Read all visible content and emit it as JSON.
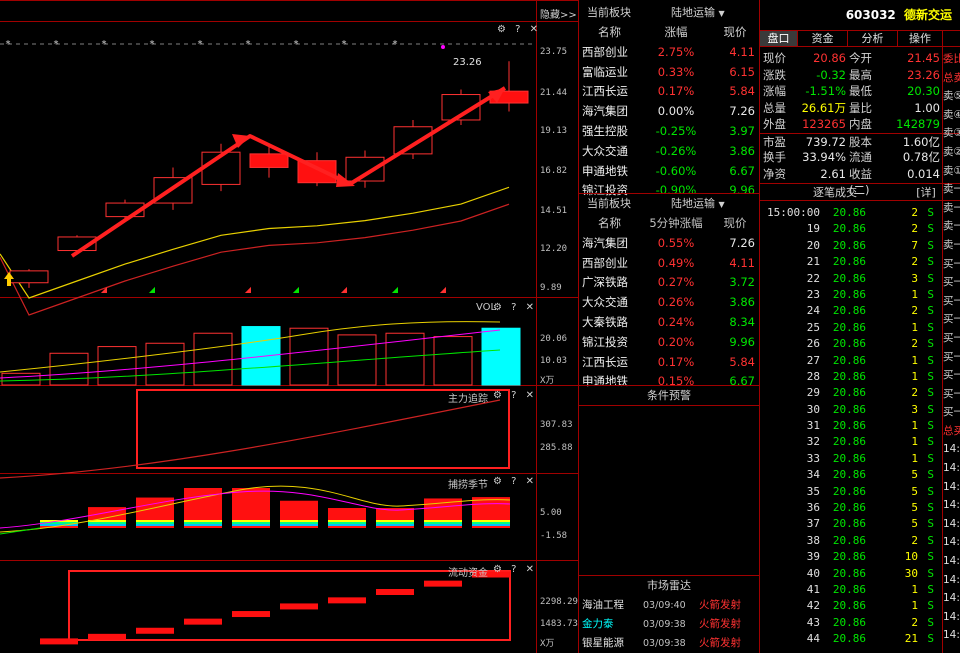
{
  "chart_top": {
    "hide_label": "隐藏>>",
    "icons": "⚙ ? ✕"
  },
  "price_axis": [
    "23.75",
    "21.44",
    "19.13",
    "16.82",
    "14.51",
    "12.20",
    "9.89"
  ],
  "high_label": "23.26",
  "vol_panel": {
    "title": "VOL",
    "icons": "⚙ ? ✕",
    "axis": [
      "20.06",
      "10.03",
      "X万"
    ]
  },
  "main_track_panel": {
    "title": "主力追踪",
    "icons": "⚙ ? ✕",
    "axis": [
      "307.83",
      "285.88"
    ]
  },
  "season_panel": {
    "title": "捕捞季节",
    "icons": "⚙ ? ✕",
    "axis": [
      "5.00",
      "-1.58"
    ]
  },
  "flow_panel": {
    "title": "流动资金",
    "icons": "⚙ ? ✕",
    "axis": [
      "2298.29",
      "1483.73",
      "X万"
    ]
  },
  "candles": [
    {
      "o": 10.2,
      "c": 10.9,
      "h": 11.0,
      "l": 9.9
    },
    {
      "o": 12.1,
      "c": 12.9,
      "h": 13.0,
      "l": 11.9
    },
    {
      "o": 14.1,
      "c": 14.9,
      "h": 15.1,
      "l": 13.9
    },
    {
      "o": 14.9,
      "c": 16.4,
      "h": 17.0,
      "l": 14.5
    },
    {
      "o": 16.0,
      "c": 17.9,
      "h": 18.4,
      "l": 15.6
    },
    {
      "o": 17.8,
      "c": 17.0,
      "h": 18.3,
      "l": 16.4
    },
    {
      "o": 17.4,
      "c": 16.1,
      "h": 17.9,
      "l": 15.9
    },
    {
      "o": 16.2,
      "c": 17.6,
      "h": 18.0,
      "l": 15.8
    },
    {
      "o": 17.8,
      "c": 19.4,
      "h": 19.8,
      "l": 17.5
    },
    {
      "o": 19.8,
      "c": 21.3,
      "h": 21.6,
      "l": 19.5
    },
    {
      "o": 21.5,
      "c": 20.8,
      "h": 23.26,
      "l": 20.3
    }
  ],
  "volumes": [
    3.5,
    9.5,
    11.5,
    12.5,
    15.5,
    17.5,
    17.0,
    15.0,
    15.5,
    14.5,
    17.0
  ],
  "season_bars": [
    1.2,
    4.6,
    6.7,
    8.8,
    8.8,
    6.0,
    4.4,
    4.4,
    6.5,
    6.8
  ],
  "flow_bars": [
    1500,
    1560,
    1640,
    1760,
    1860,
    1960,
    2040,
    2150,
    2260,
    2380
  ],
  "block1": {
    "tab": "当前板块",
    "sector": "陆地运输",
    "headers": [
      "名称",
      "涨幅",
      "现价"
    ],
    "rows": [
      {
        "name": "西部创业",
        "pct": "2.75%",
        "price": "4.11",
        "dir": "up"
      },
      {
        "name": "富临运业",
        "pct": "0.33%",
        "price": "6.15",
        "dir": "up"
      },
      {
        "name": "江西长运",
        "pct": "0.17%",
        "price": "5.84",
        "dir": "up"
      },
      {
        "name": "海汽集团",
        "pct": "0.00%",
        "price": "7.26",
        "dir": "flat"
      },
      {
        "name": "强生控股",
        "pct": "-0.25%",
        "price": "3.97",
        "dir": "down"
      },
      {
        "name": "大众交通",
        "pct": "-0.26%",
        "price": "3.86",
        "dir": "down"
      },
      {
        "name": "申通地铁",
        "pct": "-0.60%",
        "price": "6.67",
        "dir": "down"
      },
      {
        "name": "锦江投资",
        "pct": "-0.90%",
        "price": "9.96",
        "dir": "down"
      }
    ]
  },
  "block2": {
    "tab": "当前板块",
    "sector": "陆地运输",
    "headers": [
      "名称",
      "5分钟涨幅",
      "现价"
    ],
    "rows": [
      {
        "name": "海汽集团",
        "pct": "0.55%",
        "price": "7.26",
        "dir": "flat"
      },
      {
        "name": "西部创业",
        "pct": "0.49%",
        "price": "4.11",
        "dir": "up"
      },
      {
        "name": "广深铁路",
        "pct": "0.27%",
        "price": "3.72",
        "dir": "down"
      },
      {
        "name": "大众交通",
        "pct": "0.26%",
        "price": "3.86",
        "dir": "down"
      },
      {
        "name": "大秦铁路",
        "pct": "0.24%",
        "price": "8.34",
        "dir": "down"
      },
      {
        "name": "锦江投资",
        "pct": "0.20%",
        "price": "9.96",
        "dir": "down"
      },
      {
        "name": "江西长运",
        "pct": "0.17%",
        "price": "5.84",
        "dir": "up"
      },
      {
        "name": "申通地铁",
        "pct": "0.15%",
        "price": "6.67",
        "dir": "down"
      }
    ]
  },
  "alert_title": "条件预警",
  "radar": {
    "title": "市场雷达",
    "rows": [
      {
        "name": "海油工程",
        "time": "03/09:40",
        "event": "火箭发射",
        "color": "#e0e0e0"
      },
      {
        "name": "金力泰",
        "time": "03/09:38",
        "event": "火箭发射",
        "color": "#00ffff"
      },
      {
        "name": "银星能源",
        "time": "03/09:38",
        "event": "火箭发射",
        "color": "#e0e0e0"
      }
    ]
  },
  "stock": {
    "code": "603032",
    "name": "德新交运"
  },
  "quote_tabs": [
    "盘口",
    "资金",
    "分析",
    "操作"
  ],
  "quote": [
    {
      "l1": "现价",
      "v1": "20.86",
      "c1": "red",
      "l2": "今开",
      "v2": "21.45",
      "c2": "red"
    },
    {
      "l1": "涨跌",
      "v1": "-0.32",
      "c1": "green",
      "l2": "最高",
      "v2": "23.26",
      "c2": "red"
    },
    {
      "l1": "涨幅",
      "v1": "-1.51%",
      "c1": "green",
      "l2": "最低",
      "v2": "20.30",
      "c2": "green"
    },
    {
      "l1": "总量",
      "v1": "26.61万",
      "c1": "yellow",
      "l2": "量比",
      "v2": "1.00",
      "c2": "white"
    },
    {
      "l1": "外盘",
      "v1": "123265",
      "c1": "red",
      "l2": "内盘",
      "v2": "142879",
      "c2": "green"
    },
    {
      "l1": "市盈",
      "v1": "739.72",
      "c1": "white",
      "l2": "股本",
      "v2": "1.60亿",
      "c2": "white"
    },
    {
      "l1": "换手",
      "v1": "33.94%",
      "c1": "white",
      "l2": "流通",
      "v2": "0.78亿",
      "c2": "white"
    },
    {
      "l1": "净资",
      "v1": "2.61",
      "c1": "white",
      "l2": "收益(二)",
      "v2": "0.014",
      "c2": "white"
    }
  ],
  "ticks_title": "逐笔成交",
  "ticks_detail": "[详]",
  "ticks": [
    {
      "t": "15:00:00",
      "p": "20.86",
      "v": "2",
      "s": "S"
    },
    {
      "t": "19",
      "p": "20.86",
      "v": "2",
      "s": "S"
    },
    {
      "t": "20",
      "p": "20.86",
      "v": "7",
      "s": "S"
    },
    {
      "t": "21",
      "p": "20.86",
      "v": "2",
      "s": "S"
    },
    {
      "t": "22",
      "p": "20.86",
      "v": "3",
      "s": "S"
    },
    {
      "t": "23",
      "p": "20.86",
      "v": "1",
      "s": "S"
    },
    {
      "t": "24",
      "p": "20.86",
      "v": "2",
      "s": "S"
    },
    {
      "t": "25",
      "p": "20.86",
      "v": "1",
      "s": "S"
    },
    {
      "t": "26",
      "p": "20.86",
      "v": "2",
      "s": "S"
    },
    {
      "t": "27",
      "p": "20.86",
      "v": "1",
      "s": "S"
    },
    {
      "t": "28",
      "p": "20.86",
      "v": "1",
      "s": "S"
    },
    {
      "t": "29",
      "p": "20.86",
      "v": "2",
      "s": "S"
    },
    {
      "t": "30",
      "p": "20.86",
      "v": "3",
      "s": "S"
    },
    {
      "t": "31",
      "p": "20.86",
      "v": "1",
      "s": "S"
    },
    {
      "t": "32",
      "p": "20.86",
      "v": "1",
      "s": "S"
    },
    {
      "t": "33",
      "p": "20.86",
      "v": "1",
      "s": "S"
    },
    {
      "t": "34",
      "p": "20.86",
      "v": "5",
      "s": "S"
    },
    {
      "t": "35",
      "p": "20.86",
      "v": "5",
      "s": "S"
    },
    {
      "t": "36",
      "p": "20.86",
      "v": "5",
      "s": "S"
    },
    {
      "t": "37",
      "p": "20.86",
      "v": "5",
      "s": "S"
    },
    {
      "t": "38",
      "p": "20.86",
      "v": "2",
      "s": "S"
    },
    {
      "t": "39",
      "p": "20.86",
      "v": "10",
      "s": "S"
    },
    {
      "t": "40",
      "p": "20.86",
      "v": "30",
      "s": "S"
    },
    {
      "t": "41",
      "p": "20.86",
      "v": "1",
      "s": "S"
    },
    {
      "t": "42",
      "p": "20.86",
      "v": "1",
      "s": "S"
    },
    {
      "t": "43",
      "p": "20.86",
      "v": "2",
      "s": "S"
    },
    {
      "t": "44",
      "p": "20.86",
      "v": "21",
      "s": "S"
    }
  ],
  "side_strip": [
    "委比",
    "总卖",
    "卖⑤",
    "卖④",
    "卖③",
    "卖②",
    "卖①",
    "卖一",
    "卖一",
    "卖一",
    "卖一",
    "买一",
    "买一",
    "买一",
    "买一",
    "买一",
    "买一",
    "买一",
    "买一",
    "买一",
    "总买",
    "14:",
    "14:",
    "14:",
    "14:",
    "14:",
    "14:",
    "14:",
    "14:",
    "14:",
    "14:",
    "14:"
  ]
}
